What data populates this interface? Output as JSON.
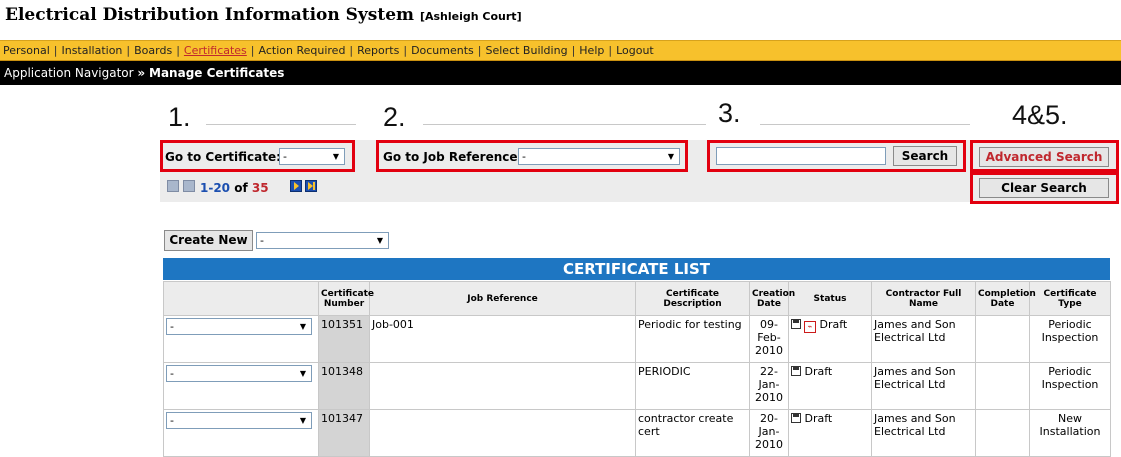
{
  "app": {
    "title": "Electrical Distribution Information System",
    "building": "[Ashleigh Court]"
  },
  "menu": {
    "items": [
      "Personal",
      "Installation",
      "Boards",
      "Certificates",
      "Action Required",
      "Reports",
      "Documents",
      "Select Building",
      "Help",
      "Logout"
    ],
    "active": "Certificates"
  },
  "breadcrumb": {
    "root": "Application Navigator",
    "separator": "»",
    "current": "Manage Certificates"
  },
  "annotations": [
    "1.",
    "2.",
    "3.",
    "4&5."
  ],
  "filters": {
    "go_to_certificate_label": "Go to Certificate:",
    "go_to_certificate_value": "-",
    "go_to_job_label": "Go to Job Reference:",
    "go_to_job_value": "-",
    "search_value": "",
    "search_button": "Search",
    "advanced_search_button": "Advanced Search",
    "clear_search_button": "Clear Search"
  },
  "pagination": {
    "range": "1-20",
    "of": "of",
    "total": "35"
  },
  "create": {
    "button": "Create New",
    "value": "-"
  },
  "table": {
    "title": "CERTIFICATE LIST",
    "columns": [
      "",
      "Certificate Number",
      "Job Reference",
      "Certificate Description",
      "Creation Date",
      "Status",
      "Contractor Full Name",
      "Completion Date",
      "Certificate Type"
    ],
    "rows": [
      {
        "select": "-",
        "number": "101351",
        "job": "Job-001",
        "desc": "Periodic for testing",
        "date": "09-Feb-2010",
        "status": "Draft",
        "pdf": true,
        "contractor": "James and Son Electrical Ltd",
        "completion": "",
        "type": "Periodic Inspection"
      },
      {
        "select": "-",
        "number": "101348",
        "job": "",
        "desc": "PERIODIC",
        "date": "22-Jan-2010",
        "status": "Draft",
        "pdf": false,
        "contractor": "James and Son Electrical Ltd",
        "completion": "",
        "type": "Periodic Inspection"
      },
      {
        "select": "-",
        "number": "101347",
        "job": "",
        "desc": "contractor create cert",
        "date": "20-Jan-2010",
        "status": "Draft",
        "pdf": false,
        "contractor": "James and Son Electrical Ltd",
        "completion": "",
        "type": "New Installation"
      }
    ]
  },
  "colors": {
    "menu": "#f7c12c",
    "crumb": "#000000",
    "table_header": "#1e76c2",
    "highlight": "#e2000f",
    "advanced_text": "#c0282e"
  }
}
